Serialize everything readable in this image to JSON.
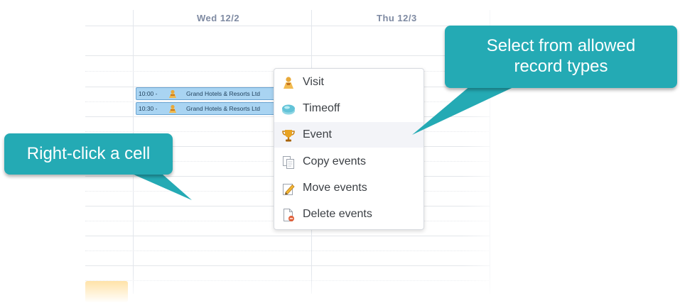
{
  "calendar": {
    "days": [
      {
        "label": "Wed 12/2"
      },
      {
        "label": "Thu 12/3"
      }
    ],
    "events": [
      {
        "time": "10:00 -",
        "title": "Grand Hotels & Resorts Ltd",
        "icon": "visit-icon"
      },
      {
        "time": "10:30 -",
        "title": "Grand Hotels & Resorts Ltd",
        "icon": "visit-icon"
      }
    ]
  },
  "context_menu": {
    "items": [
      {
        "label": "Visit",
        "icon": "visit-icon"
      },
      {
        "label": "Timeoff",
        "icon": "timeoff-icon"
      },
      {
        "label": "Event",
        "icon": "trophy-icon",
        "highlighted": true
      },
      {
        "label": "Copy events",
        "icon": "copy-icon"
      },
      {
        "label": "Move events",
        "icon": "pencil-icon"
      },
      {
        "label": "Delete events",
        "icon": "delete-doc-icon"
      }
    ]
  },
  "callouts": {
    "right_click": "Right-click a cell",
    "select_types_line1": "Select from allowed",
    "select_types_line2": "record types"
  },
  "colors": {
    "callout": "#24aab4",
    "event_fill": "#a9d4f2",
    "header_text": "#7e8aa2"
  }
}
